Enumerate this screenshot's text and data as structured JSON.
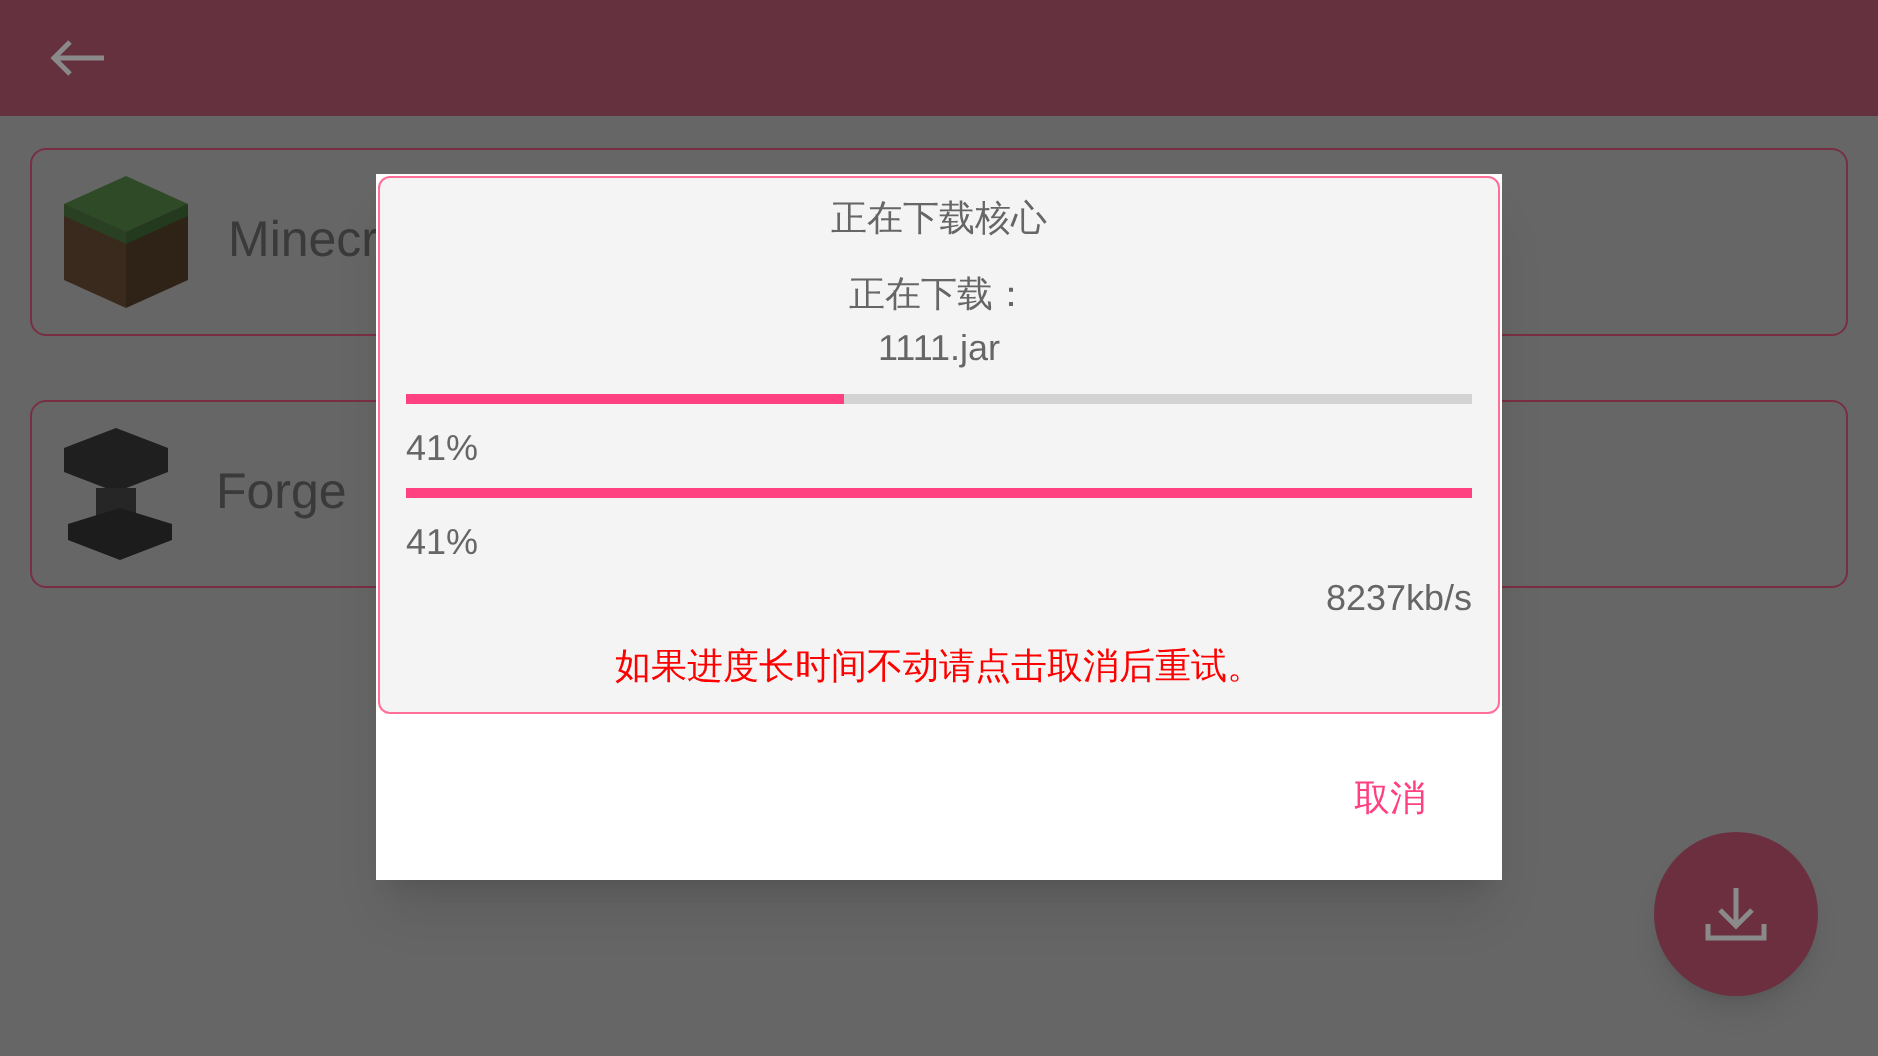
{
  "cores": [
    {
      "kind": "grass",
      "name": "Minecr"
    },
    {
      "kind": "anvil",
      "name": "Forge"
    }
  ],
  "dialog": {
    "title": "正在下载核心",
    "status_label": "正在下载：",
    "file": "1111.jar",
    "progress": [
      {
        "level": 0.41,
        "reading": "41%"
      },
      {
        "level": 1,
        "reading": "41%"
      }
    ],
    "speed": "8237kb/s",
    "hint": "如果进度长时间不动请点击取消后重试。",
    "buttons": [
      "取消"
    ]
  }
}
